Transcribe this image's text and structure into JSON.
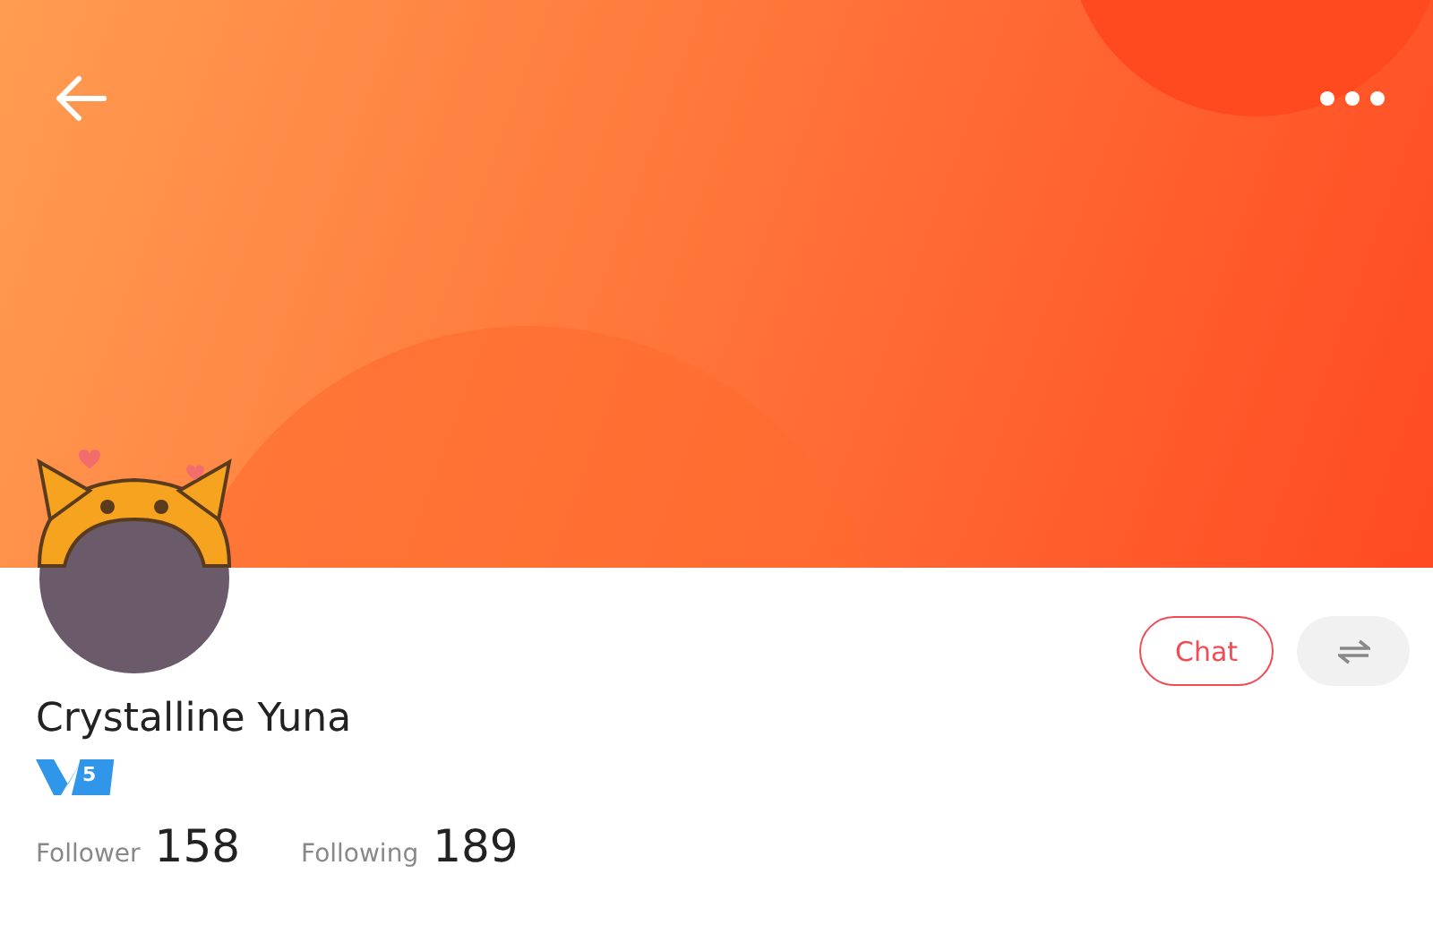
{
  "profile": {
    "name": "Crystalline Yuna",
    "level_badge": "5"
  },
  "actions": [
    {
      "kind": "chat",
      "label": "Chat"
    },
    {
      "kind": "swap"
    }
  ],
  "stats": [
    {
      "label": "Follower",
      "value": "158"
    },
    {
      "label": "Following",
      "value": "189"
    }
  ]
}
